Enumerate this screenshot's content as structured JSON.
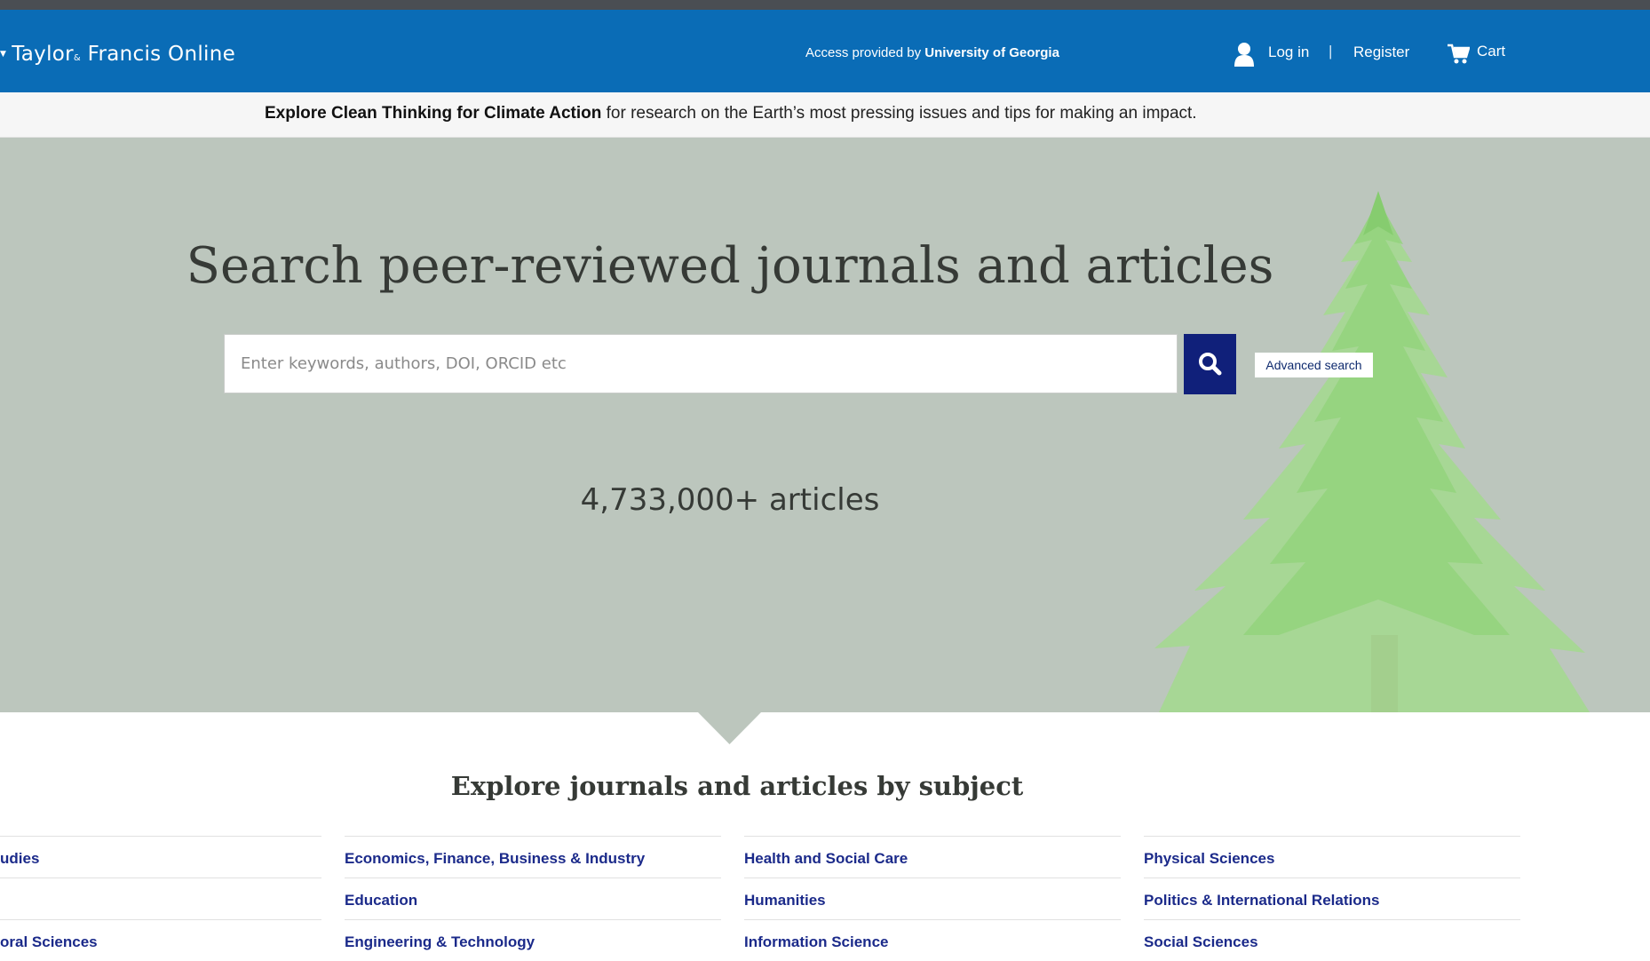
{
  "header": {
    "logo_main": "Taylor",
    "logo_amp": "&",
    "logo_rest": "Francis Online",
    "access_prefix": "Access provided by ",
    "access_org": "University of Georgia",
    "login": "Log in",
    "separator": "|",
    "register": "Register",
    "cart": "Cart"
  },
  "banner": {
    "bold": "Explore Clean Thinking for Climate Action",
    "rest": " for research on the Earth’s most pressing issues and tips for making an impact."
  },
  "hero": {
    "title": "Search peer-reviewed journals and articles",
    "search_placeholder": "Enter keywords, authors, DOI, ORCID etc",
    "search_value": "",
    "advanced": "Advanced search",
    "count": "4,733,000+ articles"
  },
  "subjects": {
    "title": "Explore journals and articles by subject",
    "columns": [
      [
        "udies",
        "",
        "oral Sciences"
      ],
      [
        "Economics, Finance, Business & Industry",
        "Education",
        "Engineering & Technology"
      ],
      [
        "Health and Social Care",
        "Humanities",
        "Information Science"
      ],
      [
        "Physical Sciences",
        "Politics & International Relations",
        "Social Sciences"
      ]
    ]
  },
  "icons": [
    "user-icon",
    "cart-icon",
    "search-icon"
  ],
  "colors": {
    "header": "#0a6cb6",
    "hero_bg": "#bcc6bd",
    "search_button": "#10207a",
    "link": "#1b2a8a"
  }
}
